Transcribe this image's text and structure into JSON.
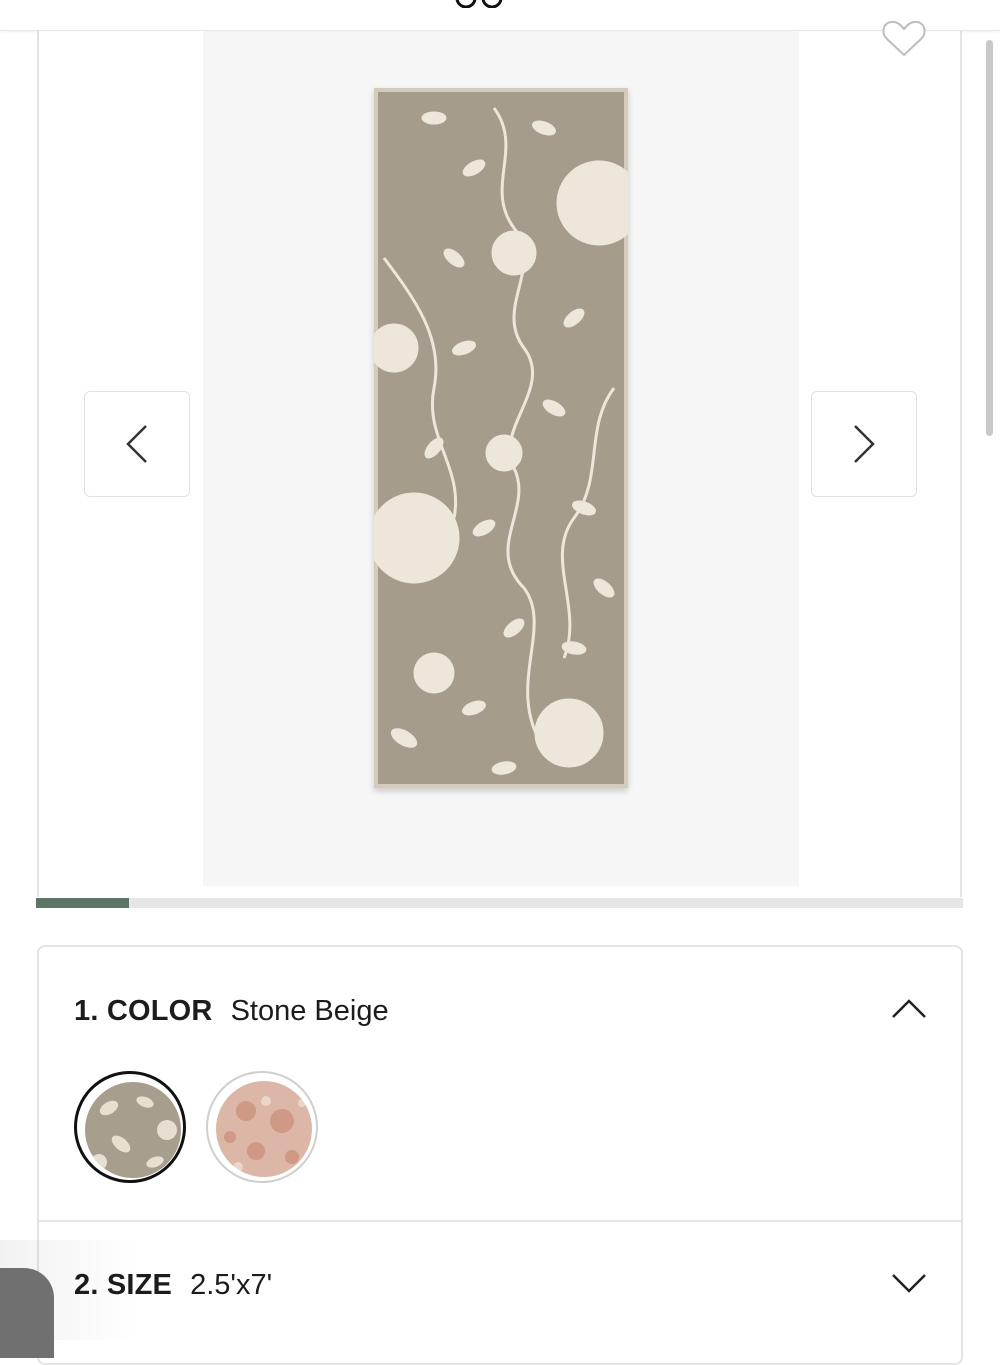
{
  "gallery": {
    "image_alt": "Floral runner rug",
    "progress_fraction": 0.1,
    "prev_icon": "chevron-left-icon",
    "next_icon": "chevron-right-icon",
    "favorite_icon": "heart-icon"
  },
  "options": {
    "color": {
      "title": "1. COLOR",
      "value": "Stone Beige",
      "expanded": true
    },
    "swatches": [
      {
        "name": "Stone Beige",
        "selected": true,
        "color": "#a79e8d"
      },
      {
        "name": "Blush",
        "selected": false,
        "color": "#dcb6a6"
      }
    ],
    "size": {
      "title": "2. SIZE",
      "value": "2.5'x7'",
      "expanded": false
    }
  },
  "colors": {
    "accent": "#5c7566",
    "rug_ground": "#a69c8b",
    "rug_pattern": "#ece7da"
  }
}
